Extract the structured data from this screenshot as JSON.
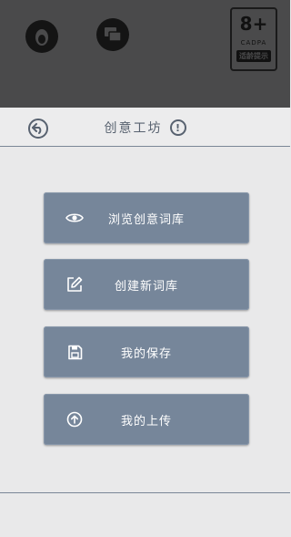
{
  "status": {
    "age_rating": "8+",
    "age_org": "CADPA",
    "age_note": "适龄提示"
  },
  "header": {
    "title": "创意工坊",
    "back_icon": "back-arrow-icon",
    "info_icon": "info-icon",
    "info_glyph": "!"
  },
  "menu": {
    "items": [
      {
        "label": "浏览创意词库",
        "icon": "eye-icon"
      },
      {
        "label": "创建新词库",
        "icon": "edit-icon"
      },
      {
        "label": "我的保存",
        "icon": "save-icon"
      },
      {
        "label": "我的上传",
        "icon": "upload-icon"
      }
    ]
  },
  "colors": {
    "topbar": "#4a4a4b",
    "background": "#e9e9ea",
    "button": "#76869a",
    "accent": "#586270"
  }
}
